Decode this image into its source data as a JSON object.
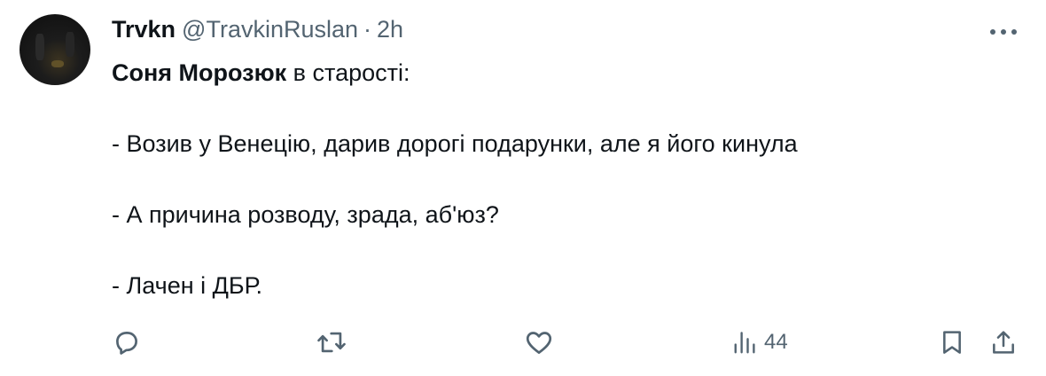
{
  "tweet": {
    "author_name": "Trvkn",
    "author_handle": "@TravkinRuslan",
    "separator": "·",
    "time": "2h",
    "mention": "Соня Морозюк",
    "first_line_rest": " в старості:",
    "lines": [
      "- Возив у Венецію, дарив дорогі подарунки, але я його кинула",
      "- А причина розводу, зрада, аб'юз?",
      "- Лачен і ДБР."
    ]
  },
  "actions": {
    "views": "44"
  },
  "icons": {
    "more": "more-icon",
    "reply": "reply-icon",
    "retweet": "retweet-icon",
    "like": "like-icon",
    "views": "views-icon",
    "bookmark": "bookmark-icon",
    "share": "share-icon"
  },
  "colors": {
    "text": "#0f1419",
    "secondary": "#536471"
  }
}
